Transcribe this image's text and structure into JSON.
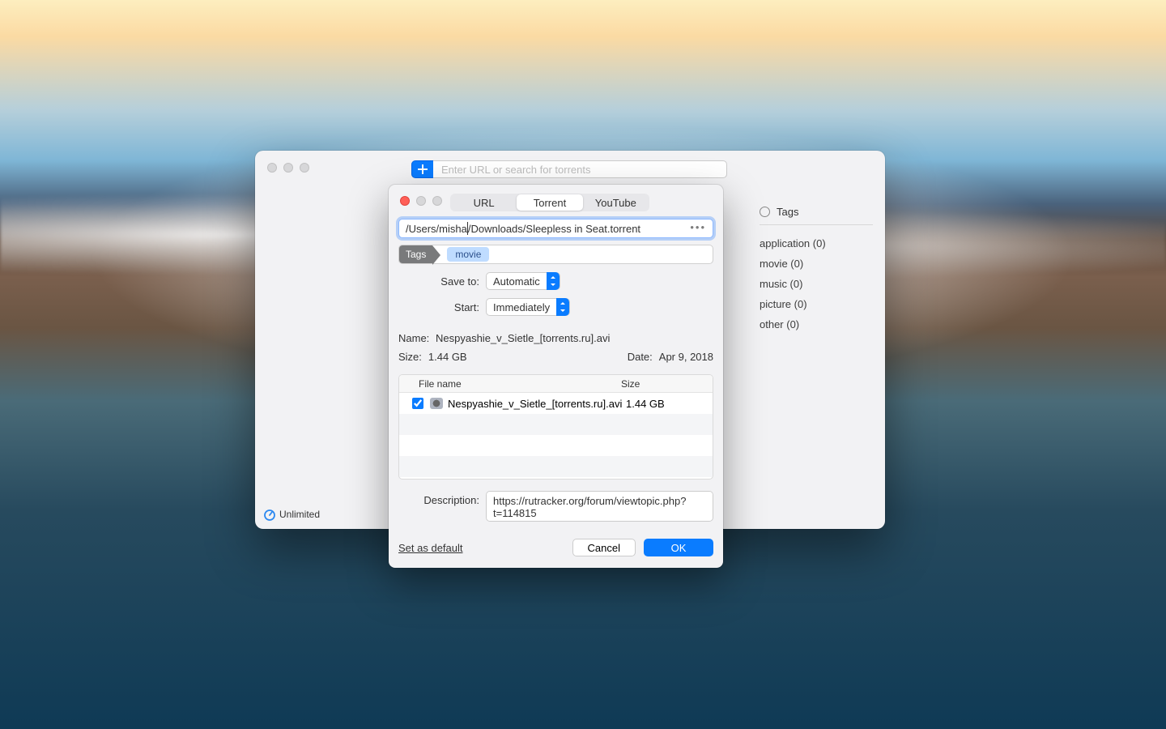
{
  "main_window": {
    "search_placeholder": "Enter URL or search for torrents",
    "status_label": "Unlimited"
  },
  "sidebar": {
    "heading": "Tags",
    "items": [
      {
        "label": "application (0)"
      },
      {
        "label": "movie (0)"
      },
      {
        "label": "music (0)"
      },
      {
        "label": "picture (0)"
      },
      {
        "label": "other (0)"
      }
    ]
  },
  "sheet": {
    "tabs": {
      "url": "URL",
      "torrent": "Torrent",
      "youtube": "YouTube",
      "active": "torrent"
    },
    "path_value": "/Users/misha/Downloads/Sleepless in Seat.torrent",
    "path_segment_a": "/Users/misha",
    "path_segment_b": "/Downloads/Sleepless in Seat.torrent",
    "tags_chip": "Tags",
    "tag_value": "movie",
    "save_to_label": "Save to:",
    "save_to_value": "Automatic",
    "start_label": "Start:",
    "start_value": "Immediately",
    "name_label": "Name:",
    "name_value": "Nespyashie_v_Sietle_[torrents.ru].avi",
    "size_label": "Size:",
    "size_value": "1.44 GB",
    "date_label": "Date:",
    "date_value": "Apr 9, 2018",
    "table": {
      "col_name": "File name",
      "col_size": "Size",
      "rows": [
        {
          "checked": true,
          "name": "Nespyashie_v_Sietle_[torrents.ru].avi",
          "size": "1.44 GB"
        }
      ]
    },
    "description_label": "Description:",
    "description_value": "https://rutracker.org/forum/viewtopic.php?t=114815",
    "set_default": "Set as default",
    "cancel": "Cancel",
    "ok": "OK"
  }
}
